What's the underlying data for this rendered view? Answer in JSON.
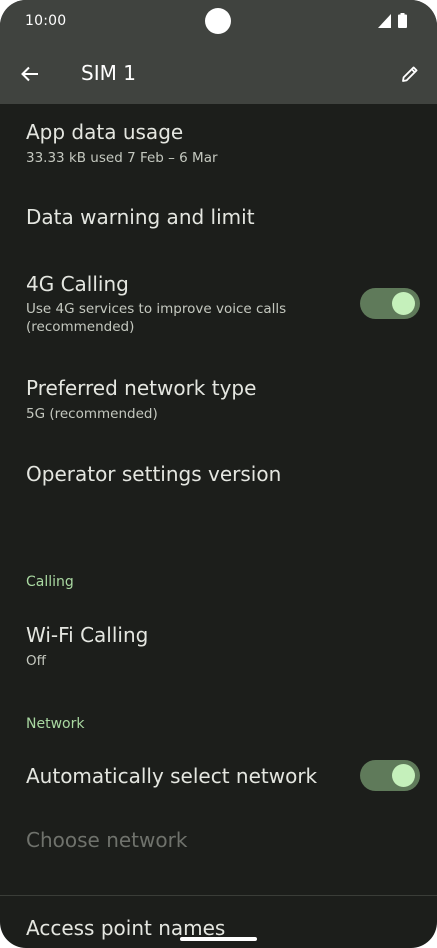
{
  "status_bar": {
    "time": "10:00",
    "icons": [
      "camera-cutout",
      "signal-icon",
      "battery-icon"
    ]
  },
  "toolbar": {
    "title": "SIM 1",
    "back_icon": "arrow-back-icon",
    "edit_icon": "pencil-icon"
  },
  "preferences": {
    "app_data_usage": {
      "title": "App data usage",
      "summary": "33.33 kB used 7 Feb – 6 Mar"
    },
    "data_warning": {
      "title": "Data warning and limit"
    },
    "calling_4g": {
      "title": "4G Calling",
      "summary_line1": "Use 4G services to improve voice calls",
      "summary_line2": "(recommended)",
      "enabled": true
    },
    "preferred_network": {
      "title": "Preferred network type",
      "summary": "5G (recommended)"
    },
    "operator_settings": {
      "title": "Operator settings version"
    }
  },
  "sections": {
    "calling": "Calling",
    "network": "Network"
  },
  "calling": {
    "wifi_calling": {
      "title": "Wi-Fi Calling",
      "summary": "Off"
    }
  },
  "network": {
    "auto_select": {
      "title": "Automatically select network",
      "enabled": true
    },
    "choose_network": {
      "title": "Choose network",
      "disabled": true
    },
    "apn": {
      "title": "Access point names"
    }
  },
  "colors": {
    "background": "#1c1e1b",
    "app_bar": "#40433f",
    "accent": "#a9d8a1",
    "toggle_track": "#5f7a5a",
    "toggle_thumb": "#c5f0bb"
  }
}
